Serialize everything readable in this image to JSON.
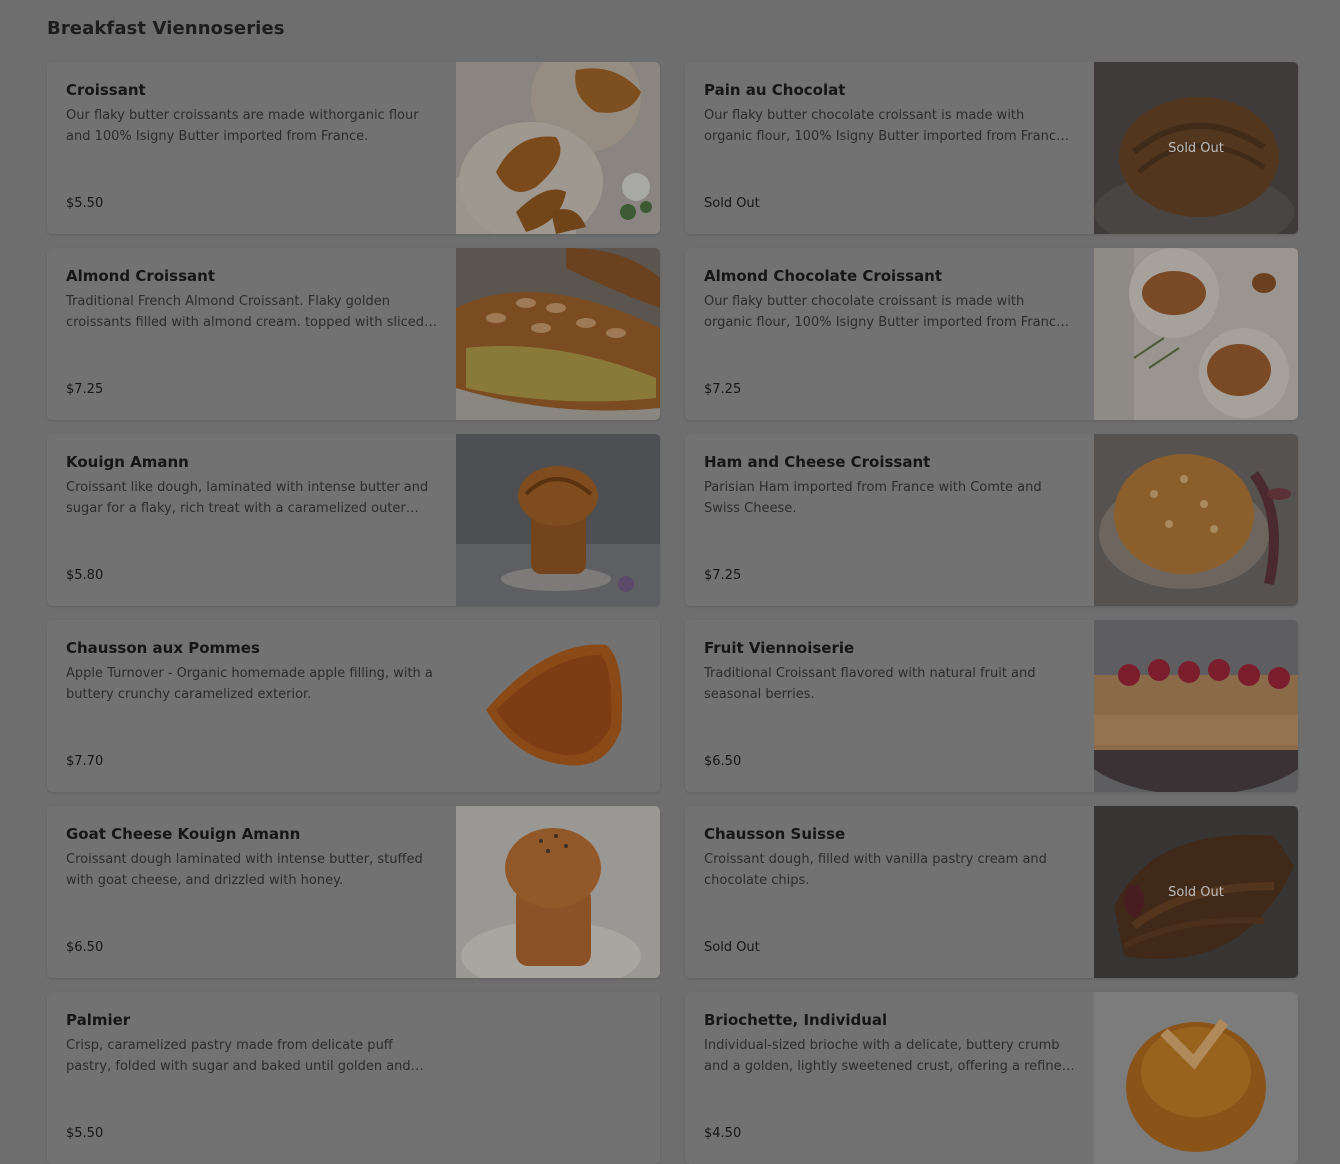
{
  "section": {
    "title": "Breakfast Viennoseries"
  },
  "items": [
    {
      "name": "Croissant",
      "description": "Our flaky butter croissants are made withorganic flour and 100% Isigny Butter imported from France.",
      "price": "$5.50",
      "image": "croissant-photo",
      "sold_out": false
    },
    {
      "name": "Pain au Chocolat",
      "description": "Our flaky butter chocolate croissant is made with organic flour, 100% Isigny Butter imported from France and chocolate.",
      "price": "Sold Out",
      "image": "pain-au-chocolat-photo",
      "sold_out": true,
      "badge": "Sold Out"
    },
    {
      "name": "Almond Croissant",
      "description": "Traditional French Almond Croissant. Flaky golden croissants filled with almond cream. topped with sliced almonds.",
      "price": "$7.25",
      "image": "almond-croissant-photo",
      "sold_out": false
    },
    {
      "name": "Almond Chocolate Croissant",
      "description": "Our flaky butter chocolate croissant is made with organic flour, 100% Isigny Butter imported from France and almond cream.",
      "price": "$7.25",
      "image": "almond-chocolate-croissant-photo",
      "sold_out": false
    },
    {
      "name": "Kouign Amann",
      "description": "Croissant like dough, laminated with intense butter and sugar for a flaky, rich treat with a caramelized outer crust.",
      "price": "$5.80",
      "image": "kouign-amann-photo",
      "sold_out": false
    },
    {
      "name": "Ham and Cheese Croissant",
      "description": "Parisian Ham imported from France with Comte and Swiss Cheese.",
      "price": "$7.25",
      "image": "ham-cheese-croissant-photo",
      "sold_out": false
    },
    {
      "name": "Chausson aux Pommes",
      "description": "Apple Turnover - Organic homemade apple filling, with a buttery crunchy caramelized exterior.",
      "price": "$7.70",
      "image": "chausson-aux-pommes-photo",
      "sold_out": false
    },
    {
      "name": "Fruit Viennoiserie",
      "description": "Traditional Croissant flavored with natural fruit and seasonal berries.",
      "price": "$6.50",
      "image": "fruit-viennoiserie-photo",
      "sold_out": false
    },
    {
      "name": "Goat Cheese Kouign Amann",
      "description": "Croissant dough laminated with intense butter, stuffed with goat cheese, and drizzled with honey.",
      "price": "$6.50",
      "image": "goat-cheese-kouign-amann-photo",
      "sold_out": false
    },
    {
      "name": "Chausson Suisse",
      "description": "Croissant dough, filled with vanilla pastry cream and chocolate chips.",
      "price": "Sold Out",
      "image": "chausson-suisse-photo",
      "sold_out": true,
      "badge": "Sold Out"
    },
    {
      "name": "Palmier",
      "description": "Crisp, caramelized pastry made from delicate puff pastry, folded with sugar and baked until golden and flaky.",
      "price": "$5.50",
      "image": "",
      "sold_out": false
    },
    {
      "name": "Briochette, Individual",
      "description": "Individual-sized brioche with a delicate, buttery crumb and a golden, lightly sweetened crust, offering a refined treat.",
      "price": "$4.50",
      "image": "briochette-photo",
      "sold_out": false
    }
  ]
}
